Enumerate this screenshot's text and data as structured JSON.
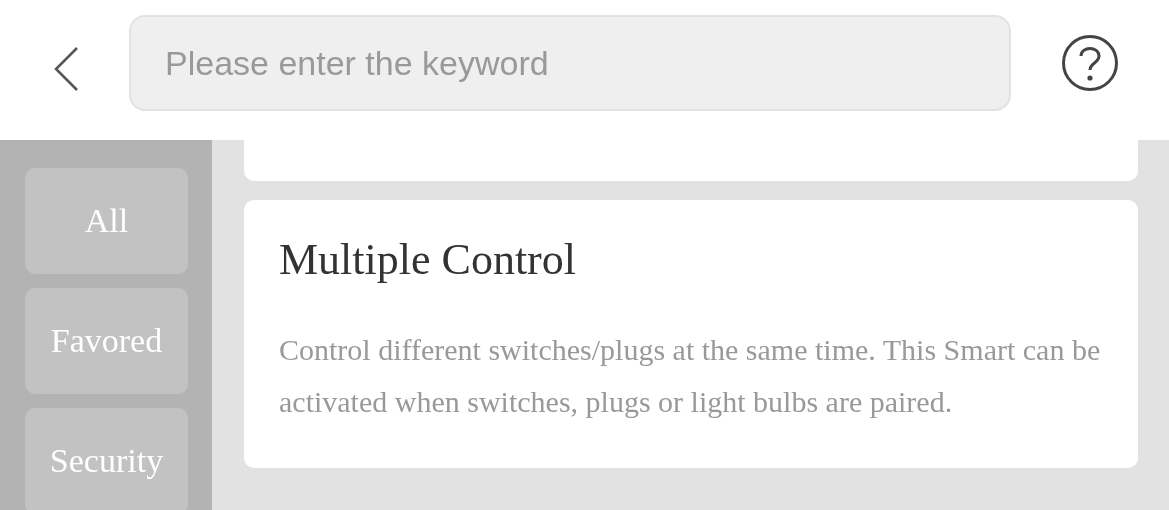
{
  "search": {
    "placeholder": "Please enter the keyword"
  },
  "sidebar": {
    "items": [
      {
        "label": "All"
      },
      {
        "label": "Favored"
      },
      {
        "label": "Security"
      }
    ]
  },
  "cards": [
    {
      "kind": "partial"
    },
    {
      "kind": "full",
      "title": "Multiple Control",
      "description": "Control different switches/plugs at the same time. This Smart can be activated when switches, plugs or light bulbs are paired."
    }
  ]
}
